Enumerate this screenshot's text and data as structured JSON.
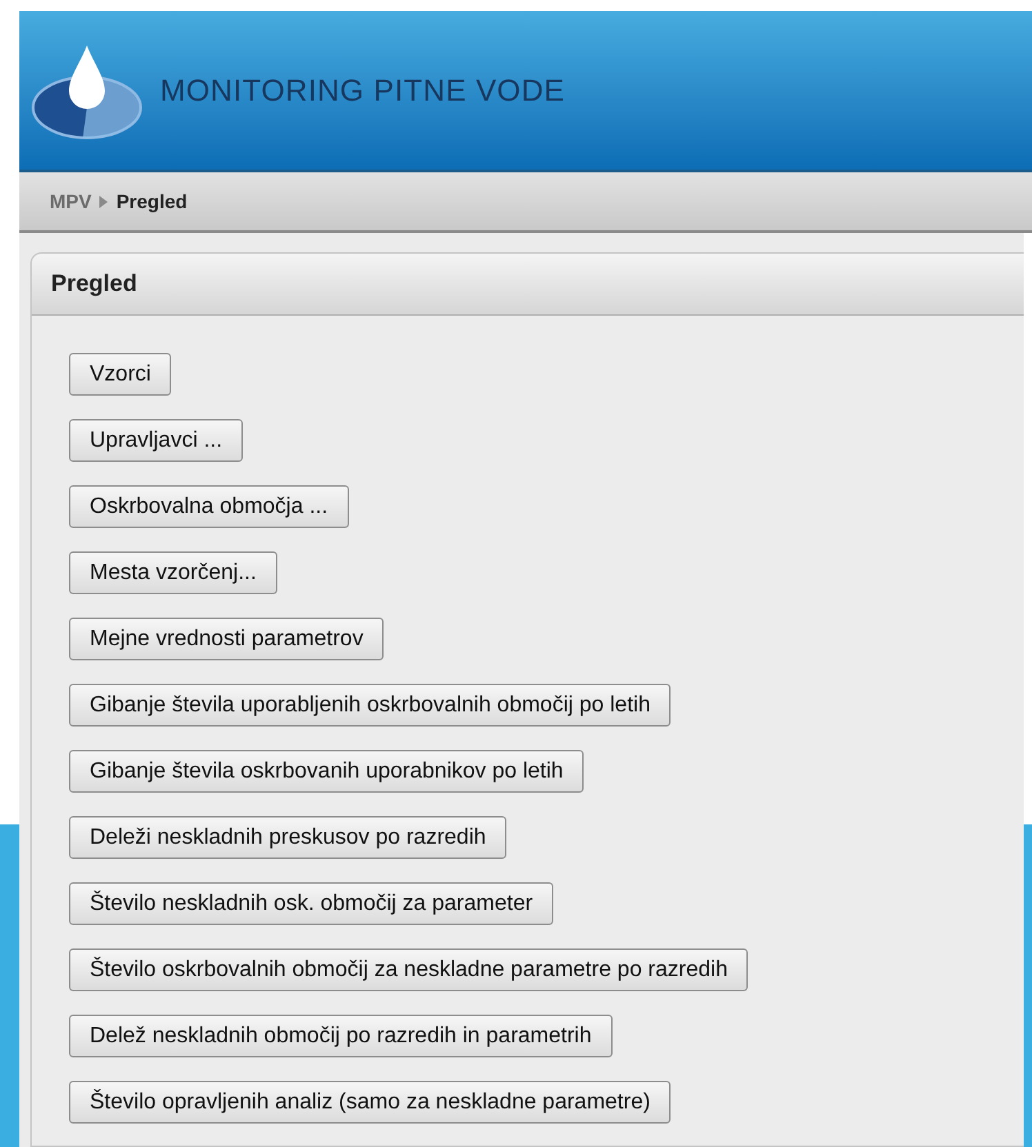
{
  "header": {
    "title": "MONITORING PITNE VODE"
  },
  "breadcrumb": [
    {
      "label": "MPV",
      "selected": false
    },
    {
      "label": "Pregled",
      "selected": true
    }
  ],
  "panel": {
    "title": "Pregled",
    "buttons": [
      "Vzorci",
      "Upravljavci ...",
      "Oskrbovalna območja ...",
      "Mesta vzorčenj...",
      "Mejne vrednosti parametrov",
      "Gibanje števila uporabljenih oskrbovalnih območij po letih",
      "Gibanje števila oskrbovanih uporabnikov po letih",
      "Deleži neskladnih preskusov po razredih",
      "Število neskladnih osk. območij za parameter",
      "Število oskrbovalnih območij za neskladne parametre po razredih",
      "Delež neskladnih območij po razredih in parametrih",
      "Število opravljenih analiz (samo za neskladne parametre)"
    ]
  }
}
